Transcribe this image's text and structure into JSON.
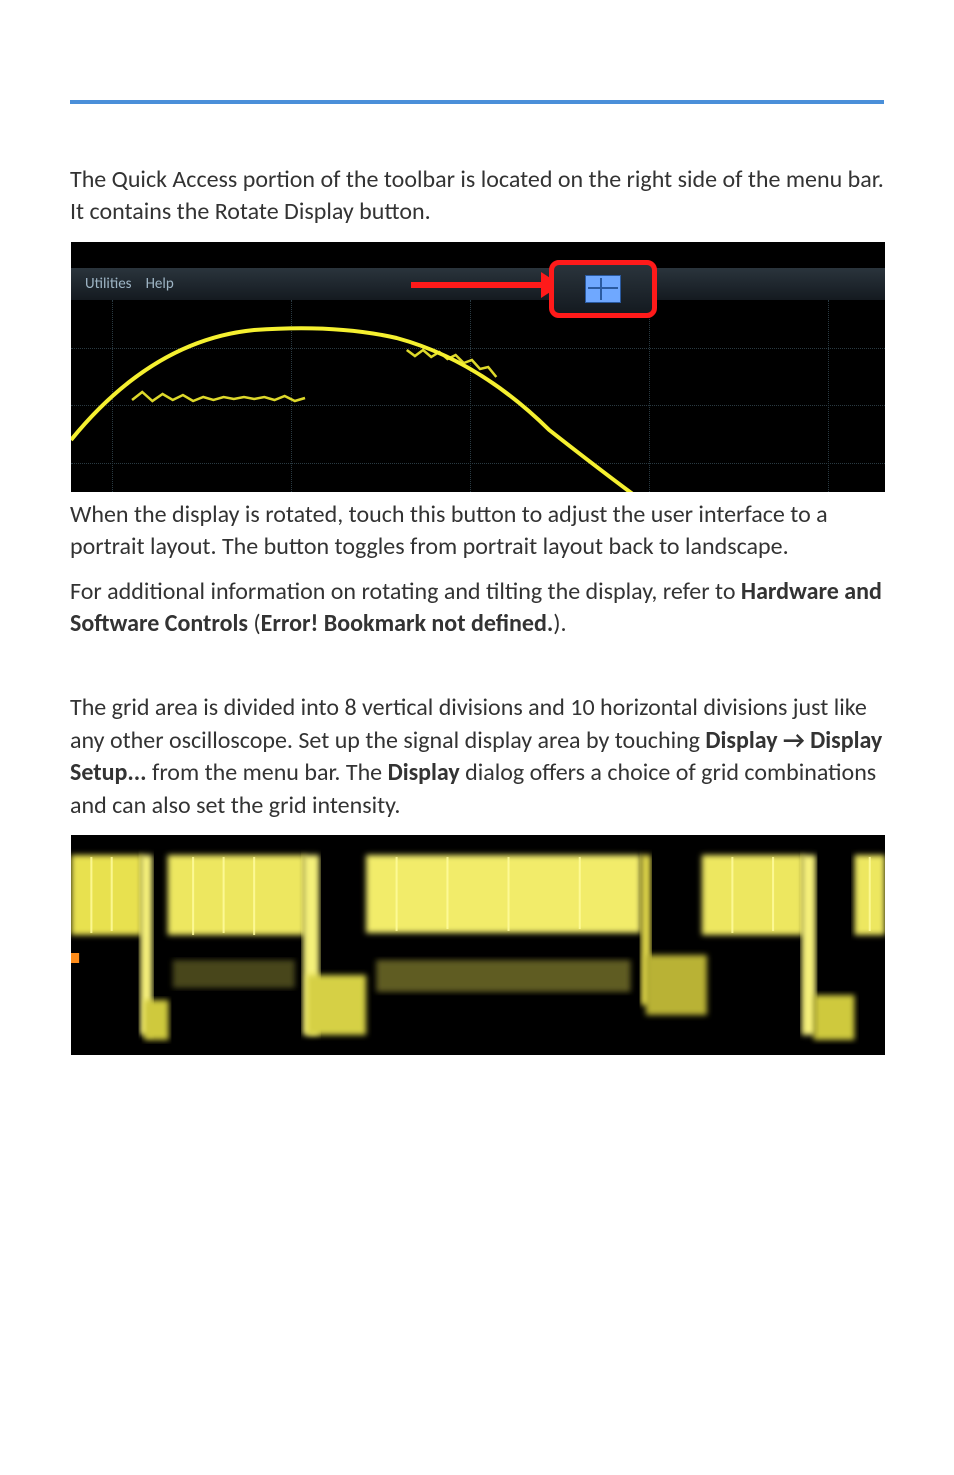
{
  "para1": "The Quick Access portion of the toolbar is located on the right side of the menu bar. It contains the Rotate Display button.",
  "screenshot1": {
    "menu_utilities": "Utilities",
    "menu_help": "Help",
    "highlight_name": "rotate-display-button"
  },
  "para2": "When the display is rotated, touch this button to adjust the user interface to a portrait layout. The button toggles from portrait layout back to landscape.",
  "para3_prefix": "For additional information on rotating and tilting the display, refer to ",
  "para3_bold1": "Hardware and Software Controls",
  "para3_mid": " (",
  "para3_bold2": "Error! Bookmark not defined.",
  "para3_suffix": ").",
  "para4_a": "The grid area is divided into 8 vertical divisions and 10 horizontal divisions just like any other oscilloscope. Set up the signal display area by touching ",
  "para4_bold1": "Display → Display Setup...",
  "para4_b": " from the menu bar. The ",
  "para4_bold2": "Display",
  "para4_c": " dialog offers a choice of grid combinations and can also set the grid intensity."
}
